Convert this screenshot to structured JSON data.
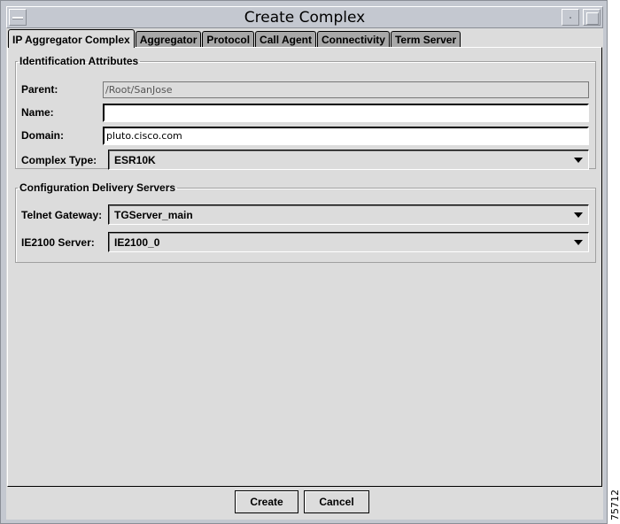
{
  "window": {
    "title": "Create Complex"
  },
  "tabs": [
    {
      "label": "IP Aggregator Complex"
    },
    {
      "label": "Aggregator"
    },
    {
      "label": "Protocol"
    },
    {
      "label": "Call Agent"
    },
    {
      "label": "Connectivity"
    },
    {
      "label": "Term Server"
    }
  ],
  "identification": {
    "legend": "Identification Attributes",
    "parent_label": "Parent:",
    "parent_value": "/Root/SanJose",
    "name_label": "Name:",
    "name_value": "",
    "domain_label": "Domain:",
    "domain_value": "pluto.cisco.com",
    "complex_type_label": "Complex Type:",
    "complex_type_value": "ESR10K"
  },
  "delivery": {
    "legend": "Configuration Delivery Servers",
    "telnet_label": "Telnet Gateway:",
    "telnet_value": "TGServer_main",
    "ie2100_label": "IE2100 Server:",
    "ie2100_value": "IE2100_0"
  },
  "buttons": {
    "create": "Create",
    "cancel": "Cancel"
  },
  "figure_number": "75712"
}
